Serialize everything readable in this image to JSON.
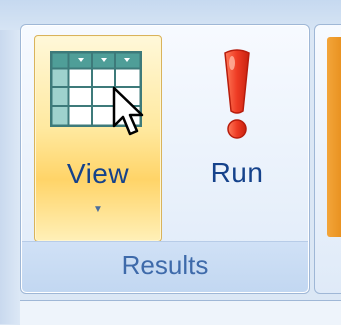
{
  "ribbon": {
    "group": {
      "label": "Results",
      "buttons": [
        {
          "label": "View",
          "icon": "datasheet-view-icon",
          "has_dropdown": true,
          "dropdown_glyph": "▼"
        },
        {
          "label": "Run",
          "icon": "run-exclamation-icon"
        }
      ]
    }
  },
  "colors": {
    "label_text": "#15428b",
    "group_label_text": "#3e6aaa",
    "hover_gold": "#ffd468",
    "run_red": "#e8342a"
  }
}
